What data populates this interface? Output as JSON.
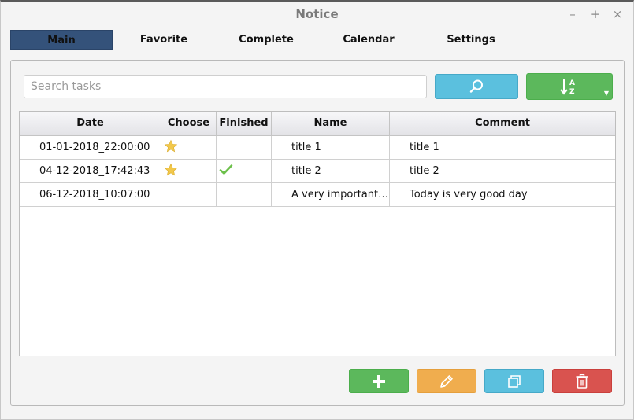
{
  "window": {
    "title": "Notice",
    "controls": {
      "minimize": "–",
      "maximize": "+",
      "close": "×"
    }
  },
  "tabs": [
    {
      "label": "Main",
      "active": true
    },
    {
      "label": "Favorite",
      "active": false
    },
    {
      "label": "Complete",
      "active": false
    },
    {
      "label": "Calendar",
      "active": false
    },
    {
      "label": "Settings",
      "active": false
    }
  ],
  "search": {
    "placeholder": "Search tasks",
    "value": ""
  },
  "toolbar": {
    "search_icon": "search-icon",
    "sort_icon": "sort-alpha-icon"
  },
  "table": {
    "columns": [
      "Date",
      "Choose",
      "Finished",
      "Name",
      "Comment"
    ],
    "rows": [
      {
        "date": "01-01-2018_22:00:00",
        "favorite": true,
        "finished": false,
        "name": "title 1",
        "comment": "title 1"
      },
      {
        "date": "04-12-2018_17:42:43",
        "favorite": true,
        "finished": true,
        "name": "title 2",
        "comment": "title 2"
      },
      {
        "date": "06-12-2018_10:07:00",
        "favorite": false,
        "finished": false,
        "name": "A very important…",
        "comment": "Today is very good day"
      }
    ]
  },
  "actions": [
    {
      "name": "add",
      "icon": "plus-icon"
    },
    {
      "name": "edit",
      "icon": "pencil-icon"
    },
    {
      "name": "copy",
      "icon": "copy-icon"
    },
    {
      "name": "delete",
      "icon": "trash-icon"
    }
  ],
  "colors": {
    "tab_active": "#34527a",
    "info": "#5bc0de",
    "success": "#5cb85c",
    "warning": "#f0ad4e",
    "danger": "#d9534f",
    "star": "#f2c84b",
    "check": "#6cc04a"
  }
}
